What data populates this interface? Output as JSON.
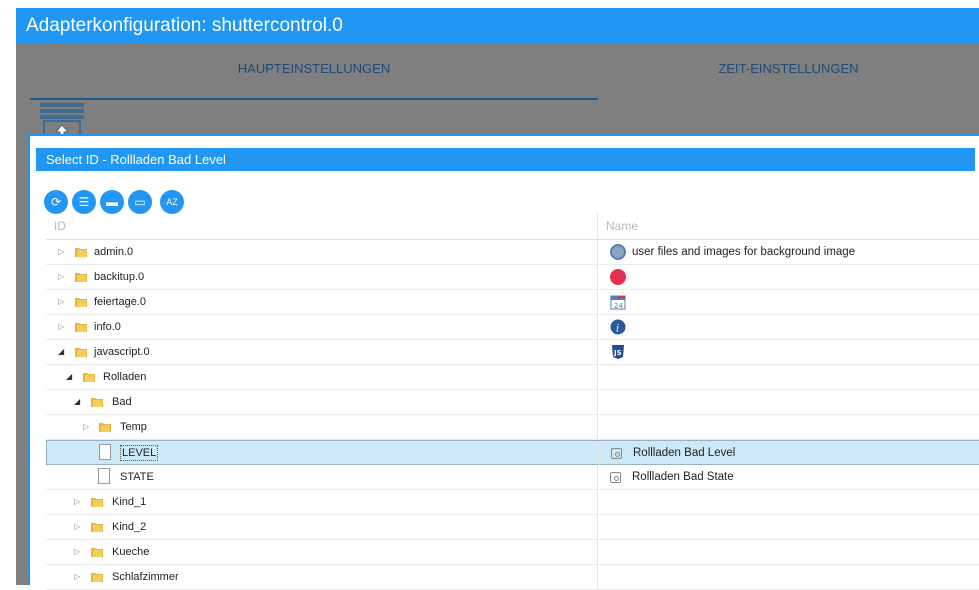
{
  "window": {
    "title": "Adapterkonfiguration: shuttercontrol.0"
  },
  "tabs": [
    {
      "label": "HAUPTEINSTELLUNGEN"
    },
    {
      "label": "ZEIT-EINSTELLUNGEN"
    }
  ],
  "dialog": {
    "title": "Select ID - Rollladen Bad Level",
    "toolbar": [
      "refresh-icon",
      "list-icon",
      "folder-icon",
      "window-icon",
      "sort-az-icon"
    ],
    "columns": {
      "id": "ID",
      "name": "Name"
    },
    "rows": [
      {
        "id": "admin.0",
        "name": "user files and images for background image",
        "icon": "admin-icon"
      },
      {
        "id": "backitup.0",
        "name": "",
        "icon": "backitup-icon"
      },
      {
        "id": "feiertage.0",
        "name": "",
        "icon": "calendar-icon"
      },
      {
        "id": "info.0",
        "name": "",
        "icon": "info-icon"
      },
      {
        "id": "javascript.0",
        "name": "",
        "icon": "javascript-icon"
      },
      {
        "id": "Rolladen",
        "name": ""
      },
      {
        "id": "Bad",
        "name": ""
      },
      {
        "id": "Temp",
        "name": ""
      },
      {
        "id": "LEVEL",
        "name": "Rollladen Bad Level"
      },
      {
        "id": "STATE",
        "name": "Rollladen Bad State"
      },
      {
        "id": "Kind_1",
        "name": ""
      },
      {
        "id": "Kind_2",
        "name": ""
      },
      {
        "id": "Kueche",
        "name": ""
      },
      {
        "id": "Schlafzimmer",
        "name": ""
      }
    ]
  },
  "colors": {
    "accent": "#2196f3",
    "selected_row": "#cde8f7",
    "tab_text": "#1e4a73"
  }
}
